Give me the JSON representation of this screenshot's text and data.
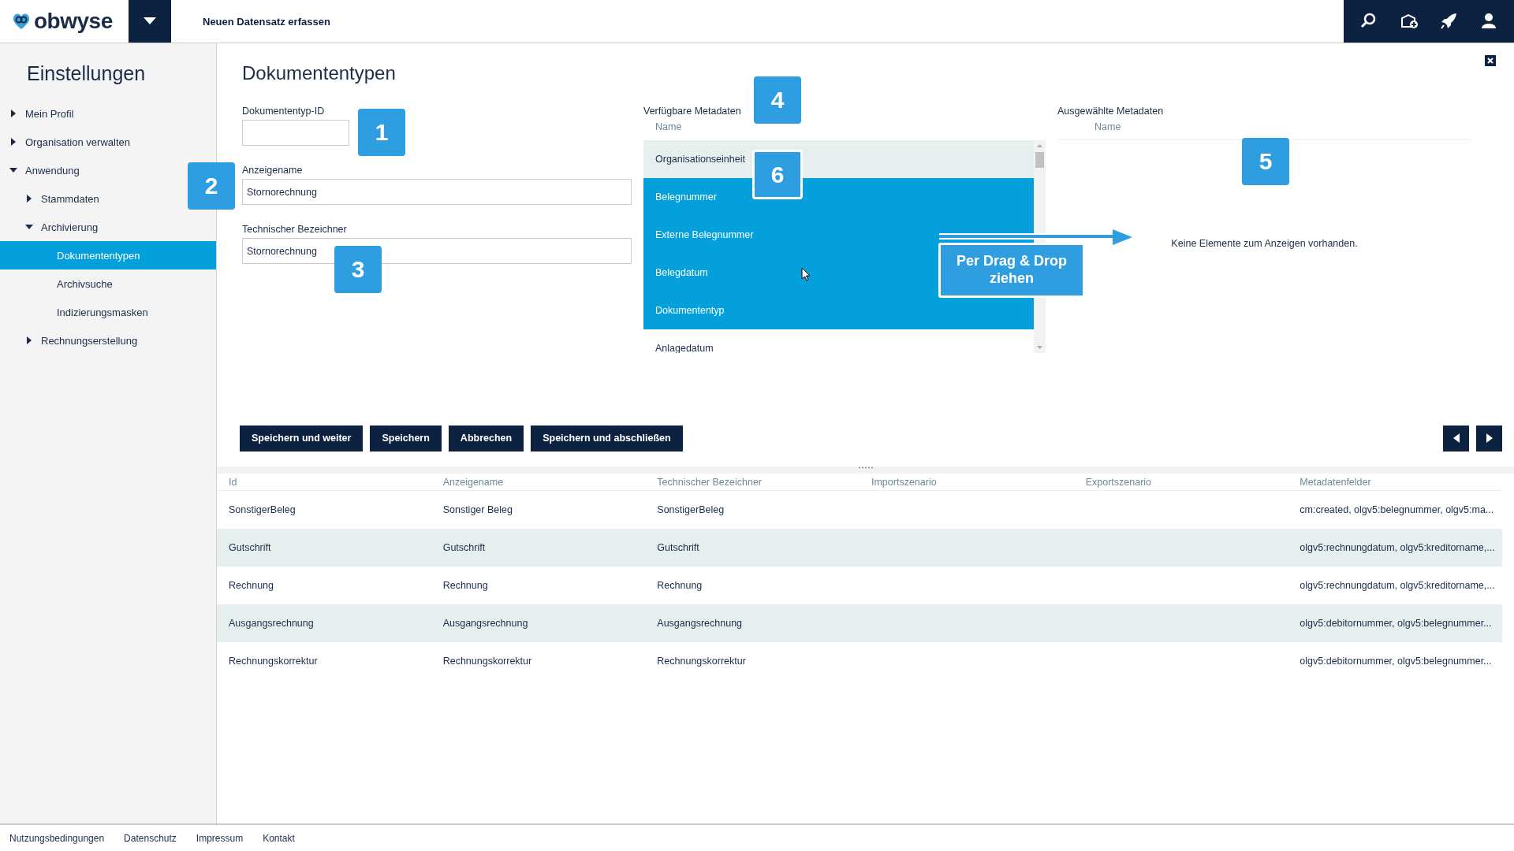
{
  "topbar": {
    "logo": "obwyse",
    "title": "Neuen Datensatz erfassen"
  },
  "sidebar": {
    "title": "Einstellungen",
    "items": [
      {
        "label": "Mein Profil",
        "expanded": false,
        "selected": false
      },
      {
        "label": "Organisation verwalten",
        "expanded": false,
        "selected": false
      },
      {
        "label": "Anwendung",
        "expanded": true,
        "selected": false,
        "children": [
          {
            "label": "Stammdaten",
            "expanded": false,
            "selected": false
          },
          {
            "label": "Archivierung",
            "expanded": true,
            "selected": false,
            "children": [
              {
                "label": "Dokumententypen",
                "selected": true
              },
              {
                "label": "Archivsuche",
                "selected": false
              },
              {
                "label": "Indizierungsmasken",
                "selected": false
              }
            ]
          },
          {
            "label": "Rechnungserstellung",
            "expanded": false,
            "selected": false
          }
        ]
      }
    ]
  },
  "page_title": "Dokumententypen",
  "form": {
    "fields": [
      {
        "label": "Dokumententyp-ID"
      },
      {
        "label": "Anzeigename",
        "value": "Stornorechnung"
      },
      {
        "label": "Technischer Bezeichner",
        "value": "Stornorechnung"
      }
    ]
  },
  "available_metadata": {
    "title": "Verfügbare Metadaten",
    "column": "Name",
    "items": [
      {
        "label": "Organisationseinheit",
        "selected": false,
        "highlighted": true
      },
      {
        "label": "Belegnummer",
        "selected": true,
        "highlighted": false
      },
      {
        "label": "Externe Belegnummer",
        "selected": true,
        "highlighted": false
      },
      {
        "label": "Belegdatum",
        "selected": true,
        "highlighted": false
      },
      {
        "label": "Dokumententyp",
        "selected": true,
        "highlighted": false
      },
      {
        "label": "Anlagedatum",
        "selected": false,
        "highlighted": false
      }
    ]
  },
  "selected_metadata": {
    "title": "Ausgewählte Metadaten",
    "column": "Name",
    "empty_message": "Keine Elemente zum Anzeigen vorhanden."
  },
  "buttons": [
    "Speichern und weiter",
    "Speichern",
    "Abbrechen",
    "Speichern und abschließen"
  ],
  "table": {
    "columns": [
      "Id",
      "Anzeigename",
      "Technischer Bezeichner",
      "Importszenario",
      "Exportszenario",
      "Metadatenfelder"
    ],
    "rows": [
      [
        "SonstigerBeleg",
        "Sonstiger Beleg",
        "SonstigerBeleg",
        "",
        "",
        "cm:created, olgv5:belegnummer, olgv5:ma..."
      ],
      [
        "Gutschrift",
        "Gutschrift",
        "Gutschrift",
        "",
        "",
        "olgv5:rechnungdatum, olgv5:kreditorname,..."
      ],
      [
        "Rechnung",
        "Rechnung",
        "Rechnung",
        "",
        "",
        "olgv5:rechnungdatum, olgv5:kreditorname,..."
      ],
      [
        "Ausgangsrechnung",
        "Ausgangsrechnung",
        "Ausgangsrechnung",
        "",
        "",
        "olgv5:debitornummer, olgv5:belegnummer..."
      ],
      [
        "Rechnungskorrektur",
        "Rechnungskorrektur",
        "Rechnungskorrektur",
        "",
        "",
        "olgv5:debitornummer, olgv5:belegnummer..."
      ]
    ]
  },
  "footer": {
    "links": [
      "Nutzungsbedingungen",
      "Datenschutz",
      "Impressum",
      "Kontakt"
    ]
  },
  "annotations": {
    "markers": [
      "1",
      "2",
      "3",
      "4",
      "5",
      "6"
    ],
    "callout": "Per Drag & Drop ziehen"
  }
}
